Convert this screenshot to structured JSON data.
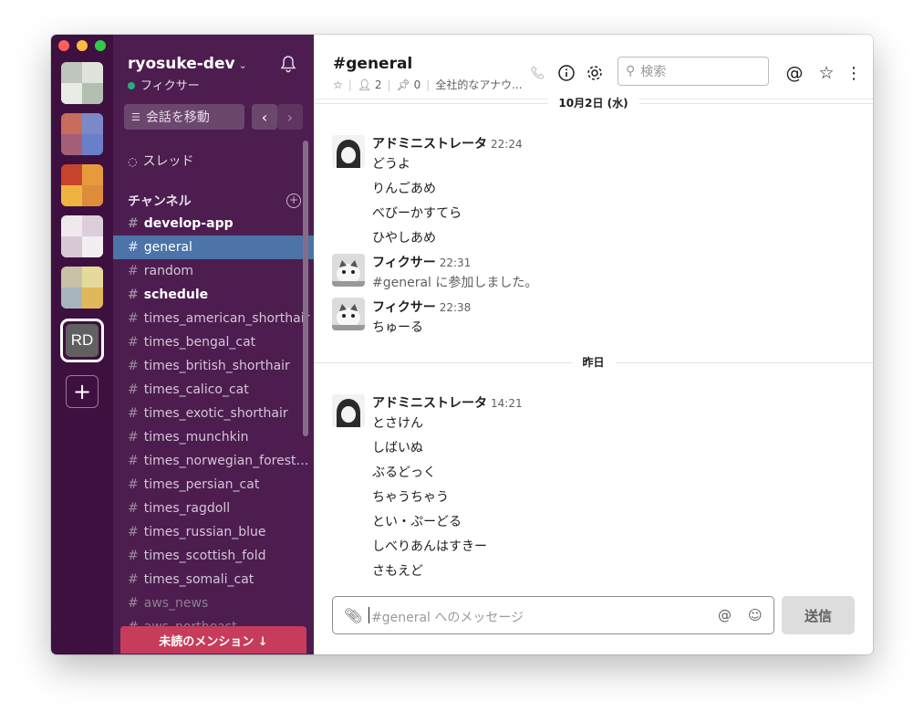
{
  "window_controls": {
    "close_color": "#fc605b",
    "minimize_color": "#fdbc40",
    "zoom_color": "#34c84a"
  },
  "rail": {
    "rd_label": "RD",
    "add_label": "+"
  },
  "sidebar": {
    "workspace_name": "ryosuke-dev",
    "user_name": "フィクサー",
    "jump_label": "会話を移動",
    "threads_label": "スレッド",
    "channels_title": "チャンネル",
    "channels": [
      {
        "name": "develop-app",
        "state": "bold"
      },
      {
        "name": "general",
        "state": "active"
      },
      {
        "name": "random",
        "state": "normal"
      },
      {
        "name": "schedule",
        "state": "bold"
      },
      {
        "name": "times_american_shorthair",
        "state": "normal"
      },
      {
        "name": "times_bengal_cat",
        "state": "normal"
      },
      {
        "name": "times_british_shorthair",
        "state": "normal"
      },
      {
        "name": "times_calico_cat",
        "state": "normal"
      },
      {
        "name": "times_exotic_shorthair",
        "state": "normal"
      },
      {
        "name": "times_munchkin",
        "state": "normal"
      },
      {
        "name": "times_norwegian_forest_…",
        "state": "normal"
      },
      {
        "name": "times_persian_cat",
        "state": "normal"
      },
      {
        "name": "times_ragdoll",
        "state": "normal"
      },
      {
        "name": "times_russian_blue",
        "state": "normal"
      },
      {
        "name": "times_scottish_fold",
        "state": "normal"
      },
      {
        "name": "times_somali_cat",
        "state": "normal"
      },
      {
        "name": "aws_news",
        "state": "dim"
      },
      {
        "name": "aws_northeast",
        "state": "dim"
      }
    ],
    "unread_label": "未読のメンション ↓"
  },
  "header": {
    "channel_title": "#general",
    "members": "2",
    "pins": "0",
    "topic": "全社的なアナウ...",
    "search_placeholder": "検索"
  },
  "days": {
    "first": "10月2日 (水)",
    "second": "昨日"
  },
  "messages": {
    "m1": {
      "sender": "アドミニストレータ",
      "time": "22:24",
      "lines": [
        "どうよ",
        "りんごあめ",
        "べびーかすてら",
        "ひやしあめ"
      ]
    },
    "m2": {
      "sender": "フィクサー",
      "time": "22:31",
      "text": "#general に参加しました。"
    },
    "m3": {
      "sender": "フィクサー",
      "time": "22:38",
      "text": "ちゅーる"
    },
    "m4": {
      "sender": "アドミニストレータ",
      "time": "14:21",
      "lines": [
        "とさけん",
        "しばいぬ",
        "ぶるどっく",
        "ちゃうちゃう",
        "とい・ぷーどる",
        "しべりあんはすきー",
        "さもえど"
      ]
    }
  },
  "composer": {
    "placeholder": "#general へのメッセージ",
    "send_label": "送信"
  }
}
